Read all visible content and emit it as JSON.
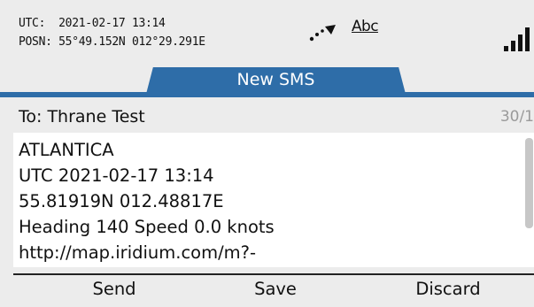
{
  "status_bar": {
    "utc_text": "UTC:  2021-02-17 13:14",
    "posn_text": "POSN: 55°49.152N 012°29.291E",
    "gps_icon": "gps-satellite-icon",
    "input_mode": "Abc",
    "signal_icon": "signal-strength-icon"
  },
  "header": {
    "title": "New SMS",
    "accent_color": "#2e6da8"
  },
  "recipient": {
    "label": "To: Thrane Test",
    "counter": "30/1"
  },
  "message": {
    "lines": [
      "ATLANTICA",
      "UTC 2021-02-17 13:14",
      "55.81919N 012.48817E",
      "Heading 140 Speed 0.0 knots",
      "http://map.iridium.com/m?-"
    ]
  },
  "softkeys": {
    "left": "Send",
    "middle": "Save",
    "right": "Discard"
  }
}
